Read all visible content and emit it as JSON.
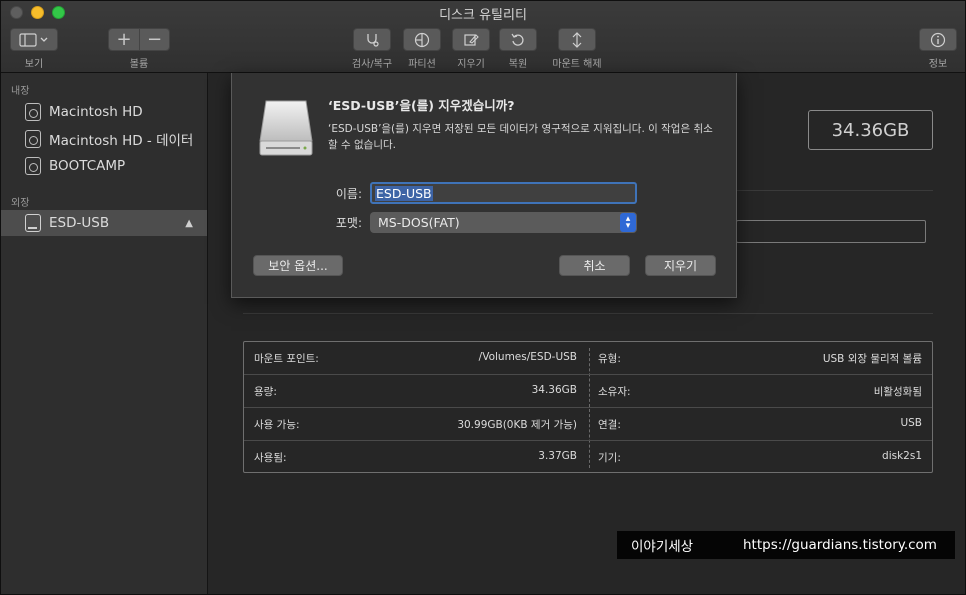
{
  "window": {
    "title": "디스크 유틸리티"
  },
  "toolbar": {
    "view_label": "보기",
    "volume_label": "볼륨",
    "volume_add": "+",
    "volume_remove": "−",
    "first_aid_label": "검사/복구",
    "partition_label": "파티션",
    "erase_label": "지우기",
    "restore_label": "복원",
    "unmount_label": "마운트 해제",
    "info_label": "정보"
  },
  "sidebar": {
    "internal_header": "내장",
    "external_header": "외장",
    "internal_items": [
      {
        "label": "Macintosh HD"
      },
      {
        "label": "Macintosh HD - 데이터"
      },
      {
        "label": "BOOTCAMP"
      }
    ],
    "external_items": [
      {
        "label": "ESD-USB",
        "selected": true
      }
    ]
  },
  "main": {
    "capacity_display": "34.36GB"
  },
  "info_table": {
    "rows": [
      {
        "l1": "마운트 포인트:",
        "v1": "/Volumes/ESD-USB",
        "l2": "유형:",
        "v2": "USB 외장 물리적 볼륨"
      },
      {
        "l1": "용량:",
        "v1": "34.36GB",
        "l2": "소유자:",
        "v2": "비활성화됨"
      },
      {
        "l1": "사용 가능:",
        "v1": "30.99GB(0KB 제거 가능)",
        "l2": "연결:",
        "v2": "USB"
      },
      {
        "l1": "사용됨:",
        "v1": "3.37GB",
        "l2": "기기:",
        "v2": "disk2s1"
      }
    ]
  },
  "dialog": {
    "title": "‘ESD-USB’을(를) 지우겠습니까?",
    "message": "‘ESD-USB’을(를) 지우면 저장된 모든 데이터가 영구적으로 지워집니다. 이 작업은 취소할 수 없습니다.",
    "name_label": "이름:",
    "name_value": "ESD-USB",
    "format_label": "포맷:",
    "format_value": "MS-DOS(FAT)",
    "security_button": "보안 옵션...",
    "cancel_button": "취소",
    "erase_button": "지우기"
  },
  "watermark": {
    "name": "이야기세상",
    "url": "https://guardians.tistory.com"
  },
  "colors": {
    "accent": "#2f69d6",
    "selection": "#3d64a6"
  }
}
